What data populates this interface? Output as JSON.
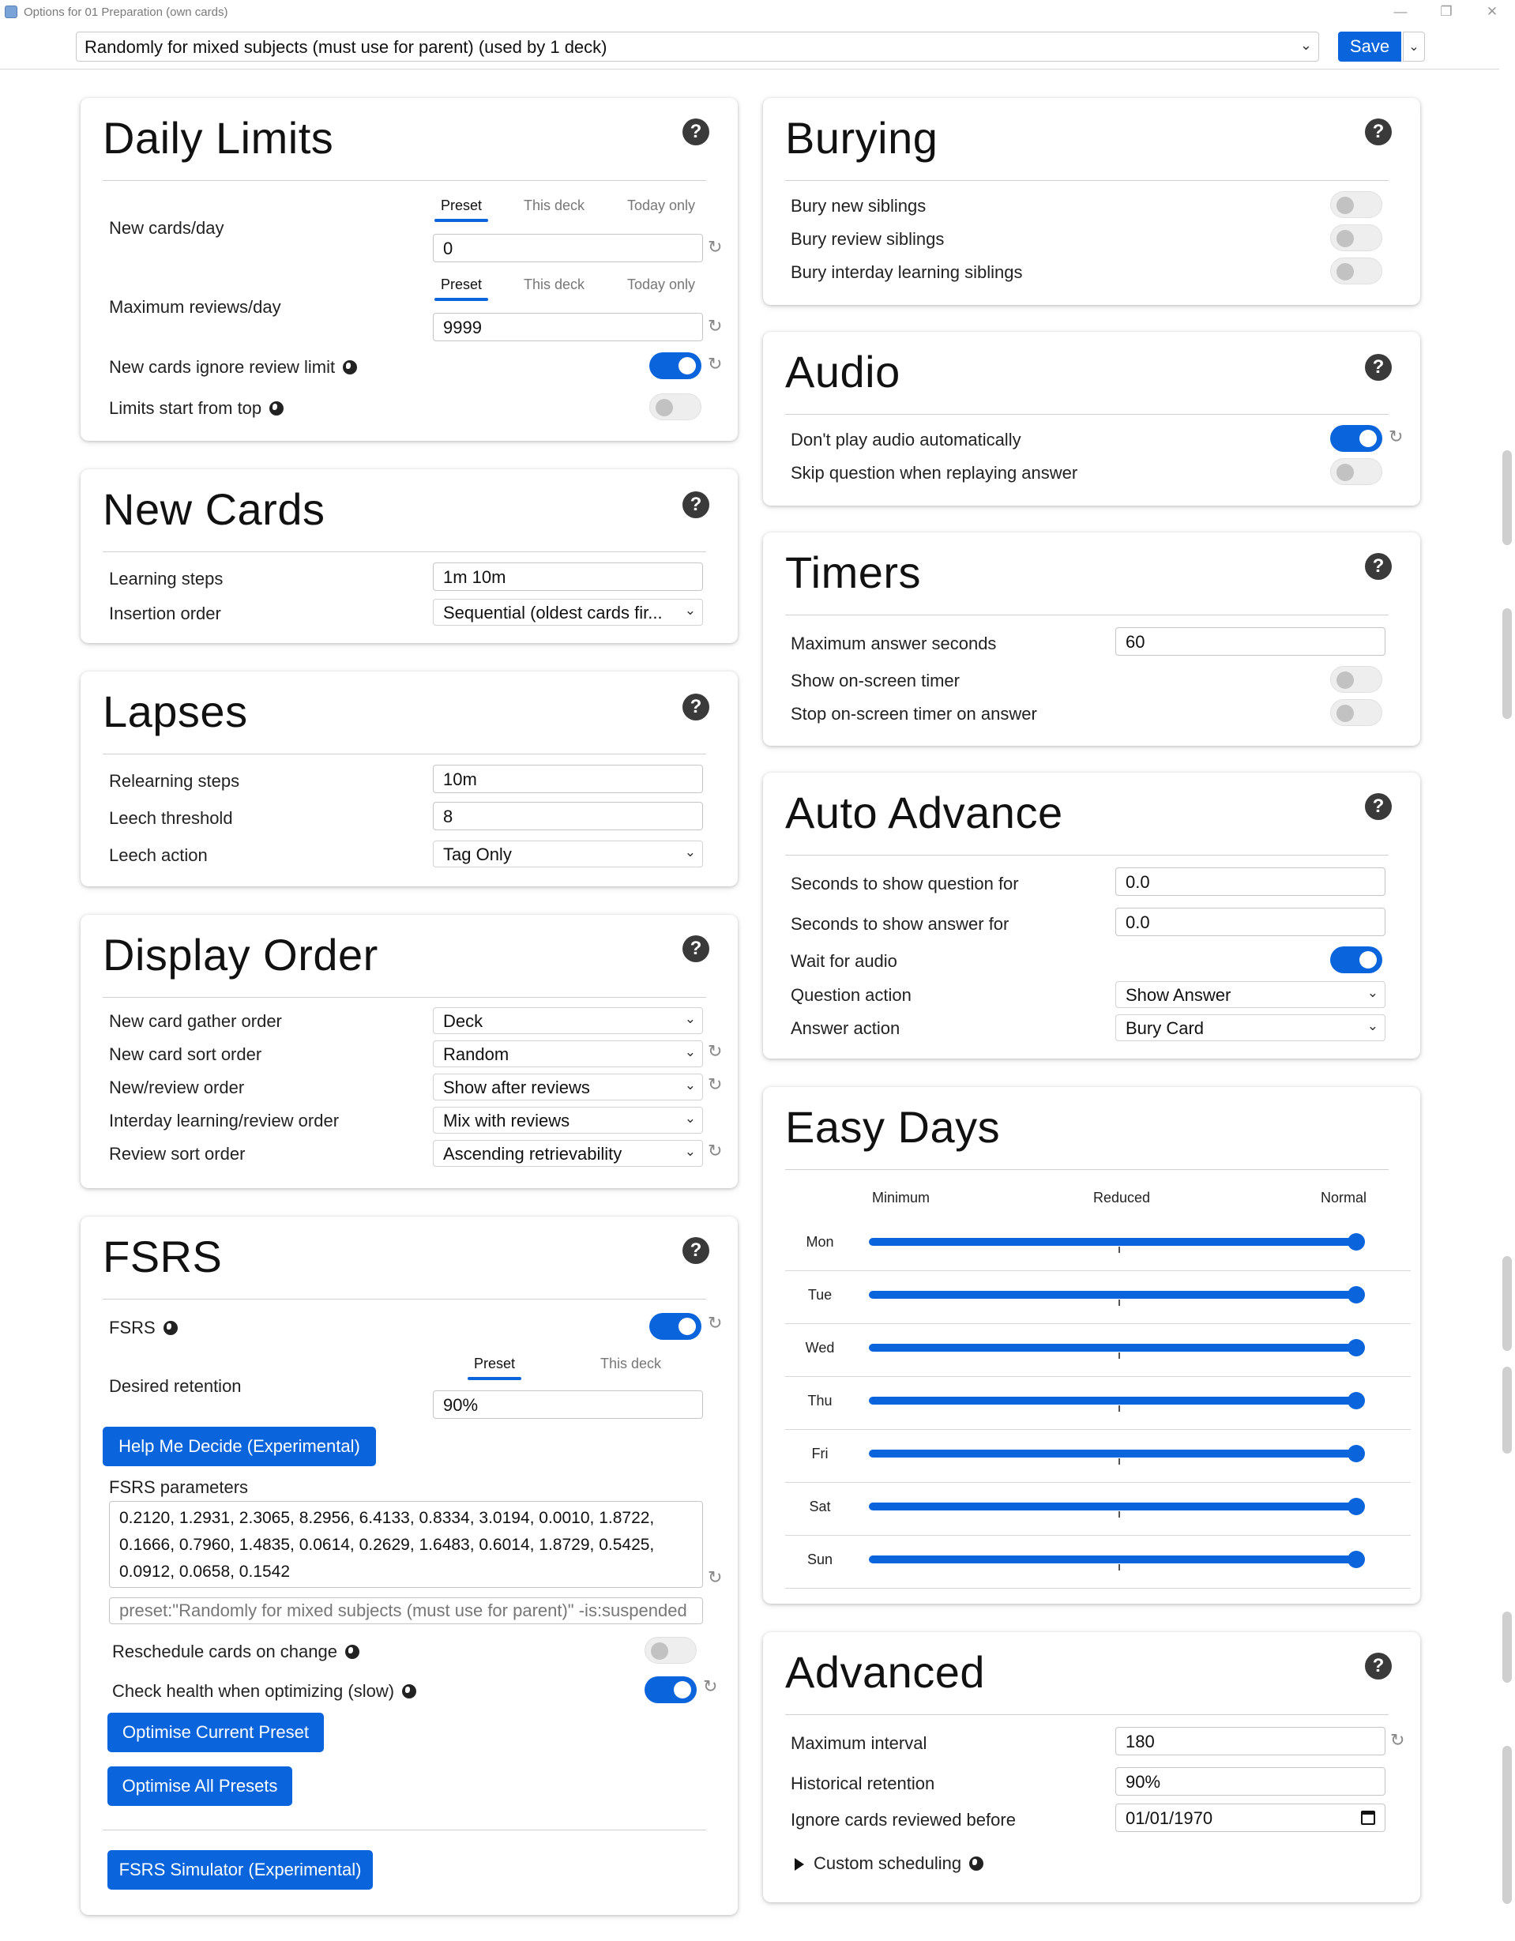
{
  "window": {
    "title": "Options for 01 Preparation (own cards)",
    "minimize": "—",
    "restore": "❐",
    "close": "✕"
  },
  "preset": {
    "selected": "Randomly for mixed subjects (must use for parent) (used by 1 deck)",
    "save_label": "Save"
  },
  "daily_limits": {
    "title": "Daily Limits",
    "tabs": [
      "Preset",
      "This deck",
      "Today only"
    ],
    "new_cards_label": "New cards/day",
    "new_cards_value": "0",
    "max_reviews_label": "Maximum reviews/day",
    "max_reviews_value": "9999",
    "ignore_limit_label": "New cards ignore review limit",
    "limits_top_label": "Limits start from top"
  },
  "new_cards": {
    "title": "New Cards",
    "learning_steps_label": "Learning steps",
    "learning_steps_value": "1m 10m",
    "insertion_order_label": "Insertion order",
    "insertion_order_value": "Sequential (oldest cards fir..."
  },
  "lapses": {
    "title": "Lapses",
    "relearning_label": "Relearning steps",
    "relearning_value": "10m",
    "leech_threshold_label": "Leech threshold",
    "leech_threshold_value": "8",
    "leech_action_label": "Leech action",
    "leech_action_value": "Tag Only"
  },
  "display_order": {
    "title": "Display Order",
    "rows": [
      {
        "label": "New card gather order",
        "value": "Deck"
      },
      {
        "label": "New card sort order",
        "value": "Random"
      },
      {
        "label": "New/review order",
        "value": "Show after reviews"
      },
      {
        "label": "Interday learning/review order",
        "value": "Mix with reviews"
      },
      {
        "label": "Review sort order",
        "value": "Ascending retrievability"
      }
    ]
  },
  "fsrs": {
    "title": "FSRS",
    "fsrs_label": "FSRS",
    "tabs": [
      "Preset",
      "This deck"
    ],
    "retention_label": "Desired retention",
    "retention_value": "90%",
    "help_decide": "Help Me Decide (Experimental)",
    "params_label": "FSRS parameters",
    "params_value": "0.2120, 1.2931, 2.3065, 8.2956, 6.4133, 0.8334, 3.0194, 0.0010, 1.8722, 0.1666, 0.7960, 1.4835, 0.0614, 0.2629, 1.6483, 0.6014, 1.8729, 0.5425, 0.0912, 0.0658, 0.1542",
    "search_value": "preset:\"Randomly for mixed subjects (must use for parent)\" -is:suspended",
    "reschedule_label": "Reschedule cards on change",
    "health_label": "Check health when optimizing (slow)",
    "optimise_current": "Optimise Current Preset",
    "optimise_all": "Optimise All Presets",
    "simulator": "FSRS Simulator (Experimental)"
  },
  "burying": {
    "title": "Burying",
    "rows": [
      "Bury new siblings",
      "Bury review siblings",
      "Bury interday learning siblings"
    ]
  },
  "audio": {
    "title": "Audio",
    "no_autoplay_label": "Don't play audio automatically",
    "skip_question_label": "Skip question when replaying answer"
  },
  "timers": {
    "title": "Timers",
    "max_answer_label": "Maximum answer seconds",
    "max_answer_value": "60",
    "show_timer_label": "Show on-screen timer",
    "stop_timer_label": "Stop on-screen timer on answer"
  },
  "auto_advance": {
    "title": "Auto Advance",
    "q_seconds_label": "Seconds to show question for",
    "q_seconds_value": "0.0",
    "a_seconds_label": "Seconds to show answer for",
    "a_seconds_value": "0.0",
    "wait_audio_label": "Wait for audio",
    "q_action_label": "Question action",
    "q_action_value": "Show Answer",
    "a_action_label": "Answer action",
    "a_action_value": "Bury Card"
  },
  "easy_days": {
    "title": "Easy Days",
    "headers": [
      "Minimum",
      "Reduced",
      "Normal"
    ],
    "days": [
      "Mon",
      "Tue",
      "Wed",
      "Thu",
      "Fri",
      "Sat",
      "Sun"
    ],
    "level": 1.0
  },
  "advanced": {
    "title": "Advanced",
    "max_interval_label": "Maximum interval",
    "max_interval_value": "180",
    "hist_retention_label": "Historical retention",
    "hist_retention_value": "90%",
    "ignore_before_label": "Ignore cards reviewed before",
    "ignore_before_value": "01/01/1970",
    "custom_scheduling_label": "Custom scheduling"
  },
  "colors": {
    "accent": "#0a64dc"
  }
}
